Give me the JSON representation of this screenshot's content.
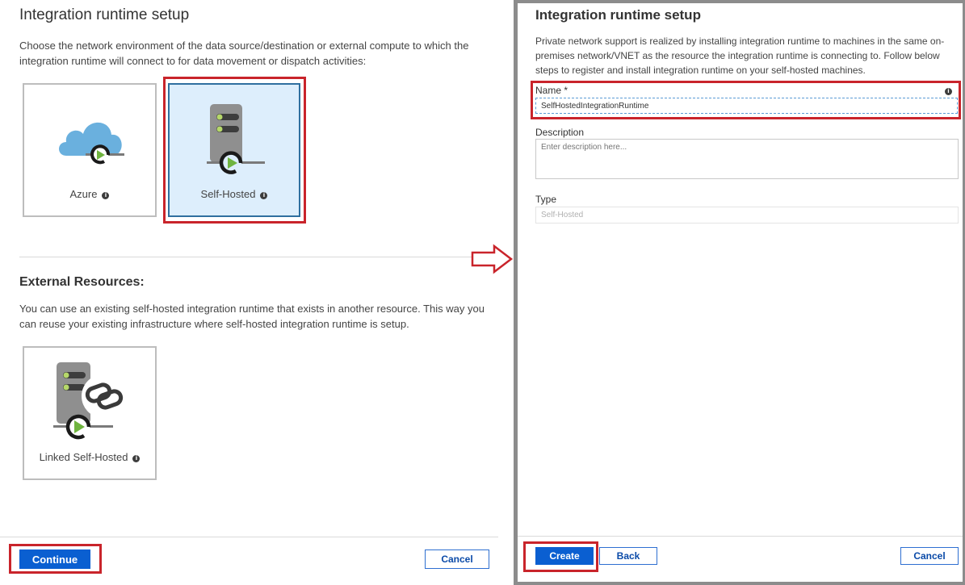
{
  "left": {
    "title": "Integration runtime setup",
    "description": "Choose the network environment of the data source/destination or external compute to which the integration runtime will connect to for data movement or dispatch activities:",
    "options": [
      {
        "label": "Azure"
      },
      {
        "label": "Self-Hosted",
        "selected": true
      }
    ],
    "external": {
      "title": "External Resources:",
      "description": "You can use an existing self-hosted integration runtime that exists in another resource. This way you can reuse your existing infrastructure where self-hosted integration runtime is setup.",
      "option": {
        "label": "Linked Self-Hosted"
      }
    },
    "footer": {
      "continue_label": "Continue",
      "cancel_label": "Cancel"
    }
  },
  "right": {
    "title": "Integration runtime setup",
    "description": "Private network support is realized by installing integration runtime to machines in the same on-premises network/VNET as the resource the integration runtime is connecting to. Follow below steps to register and install integration runtime on your self-hosted machines.",
    "name": {
      "label": "Name *",
      "value": "SelfHostedIntegrationRuntime"
    },
    "description_field": {
      "label": "Description",
      "placeholder": "Enter description here..."
    },
    "type": {
      "label": "Type",
      "value": "Self-Hosted"
    },
    "footer": {
      "create_label": "Create",
      "back_label": "Back",
      "cancel_label": "Cancel"
    }
  },
  "colors": {
    "accent": "#0a5fd1",
    "highlight": "#c9242b",
    "selected_tile": "#ddeefc",
    "selected_border": "#2f6f9f"
  },
  "icons": [
    "cloud-play-icon",
    "server-play-icon",
    "linked-server-icon",
    "info-icon",
    "right-arrow-icon"
  ]
}
